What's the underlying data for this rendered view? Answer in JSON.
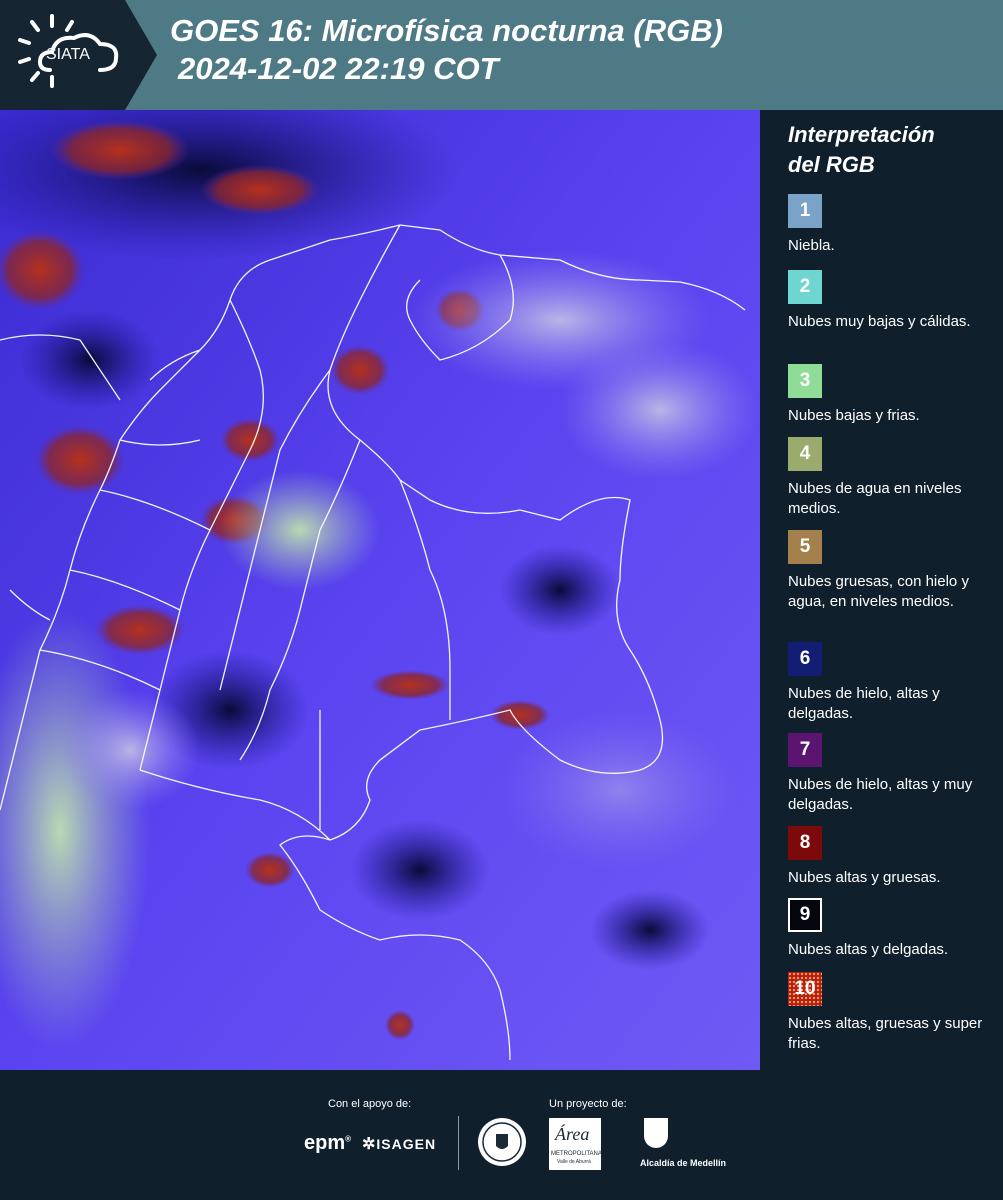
{
  "header": {
    "logo_text": "SIATA",
    "title_line1": "GOES 16: Microfísica nocturna (RGB)",
    "title_line2": "2024-12-02 22:19 COT"
  },
  "legend": {
    "title_line1": "Interpretación",
    "title_line2": "del RGB",
    "items": [
      {
        "num": "1",
        "label": "Niebla.",
        "color": "#7ba3c7"
      },
      {
        "num": "2",
        "label": "Nubes muy bajas y cálidas.",
        "color": "#6fd6cf"
      },
      {
        "num": "3",
        "label": "Nubes bajas y frias.",
        "color": "#8fdc96"
      },
      {
        "num": "4",
        "label": "Nubes de agua en niveles medios.",
        "color": "#9aab6e"
      },
      {
        "num": "5",
        "label": "Nubes gruesas, con hielo y agua, en niveles medios.",
        "color": "#a4814c"
      },
      {
        "num": "6",
        "label": "Nubes de hielo, altas y delgadas.",
        "color": "#141d74"
      },
      {
        "num": "7",
        "label": "Nubes de hielo, altas y muy delgadas.",
        "color": "#5b1470"
      },
      {
        "num": "8",
        "label": "Nubes altas y gruesas.",
        "color": "#7d0a0a"
      },
      {
        "num": "9",
        "label": "Nubes altas y delgadas.",
        "color": "#060610"
      },
      {
        "num": "10",
        "label": "Nubes altas, gruesas y super frias.",
        "color": "#b8230d"
      }
    ]
  },
  "footer": {
    "support_label": "Con el apoyo de:",
    "project_label": "Un proyecto de:",
    "logo_epm": "epm",
    "logo_isagen": "ISAGEN",
    "logo_area_line1": "METROPOLITANA",
    "logo_area_line2": "Valle de Aburrá",
    "logo_alcaldia": "Alcaldía de Medellín"
  }
}
